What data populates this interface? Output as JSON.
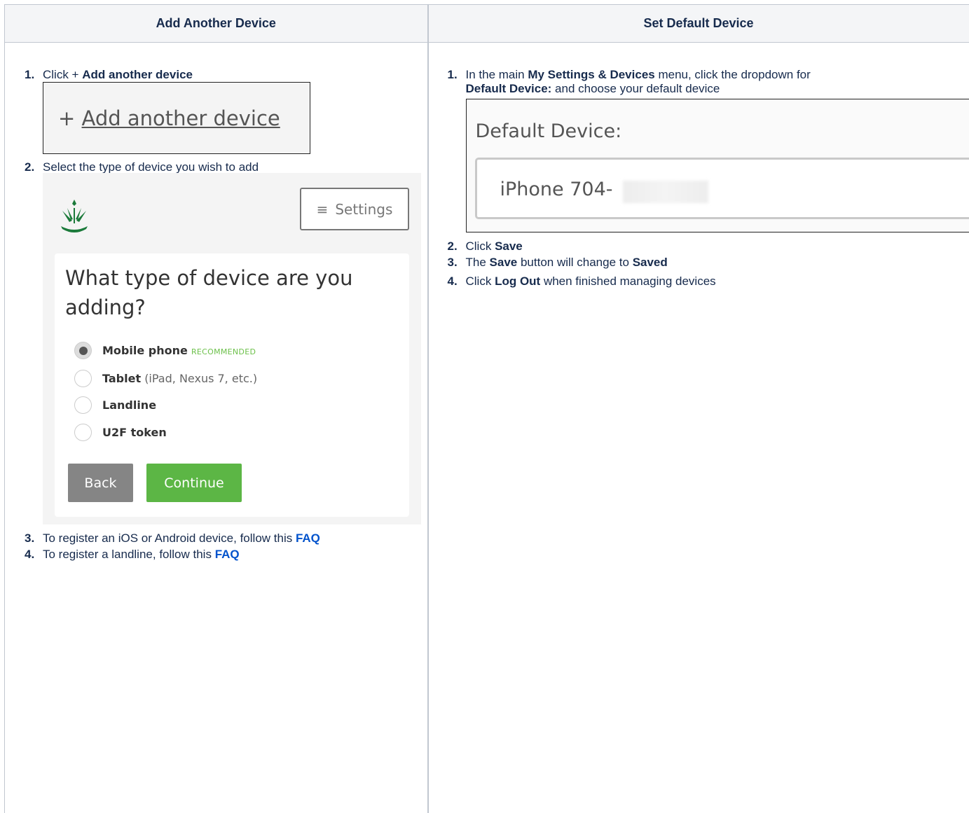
{
  "headers": {
    "add": "Add Another Device",
    "default": "Set Default Device"
  },
  "left": {
    "step1": {
      "num": "1.",
      "text": "Click + ",
      "bold": "Add another device"
    },
    "add_image": {
      "plus": "+ ",
      "link": "Add another device"
    },
    "step2": {
      "num": "2.",
      "text": "Select the type of device you wish to add"
    },
    "picker": {
      "settings_icon": "hamburger-icon",
      "settings_label": "Settings",
      "title": "What type of device are you adding?",
      "options": [
        {
          "label": "Mobile phone",
          "badge": "RECOMMENDED",
          "sub": "",
          "selected": true
        },
        {
          "label": "Tablet",
          "badge": "",
          "sub": "(iPad, Nexus 7, etc.)",
          "selected": false
        },
        {
          "label": "Landline",
          "badge": "",
          "sub": "",
          "selected": false
        },
        {
          "label": "U2F token",
          "badge": "",
          "sub": "",
          "selected": false
        }
      ],
      "back": "Back",
      "continue": "Continue"
    },
    "step3": {
      "num": "3.",
      "text": "To register an iOS or Android device, follow this ",
      "link": "FAQ"
    },
    "step4": {
      "num": "4.",
      "text": "To register a landline, follow this ",
      "link": "FAQ"
    }
  },
  "right": {
    "step1": {
      "num": "1.",
      "pre": "In the main ",
      "bold1": "My Settings & Devices",
      "mid": " menu, click the dropdown for",
      "bold2": "Default Device:",
      "post": " and choose your default device"
    },
    "default_image": {
      "label": "Default Device:",
      "value": "iPhone 704-"
    },
    "step2": {
      "num": "2.",
      "text": "Click ",
      "bold": "Save"
    },
    "step3": {
      "num": "3.",
      "pre": "The ",
      "bold1": "Save",
      "mid": " button will change to ",
      "bold2": "Saved"
    },
    "step4": {
      "num": "4.",
      "pre": "Click ",
      "bold": "Log Out",
      "post": " when finished managing devices"
    }
  },
  "colors": {
    "link": "#0052cc",
    "accent_green": "#5cb645",
    "header_bg": "#f4f5f7"
  }
}
